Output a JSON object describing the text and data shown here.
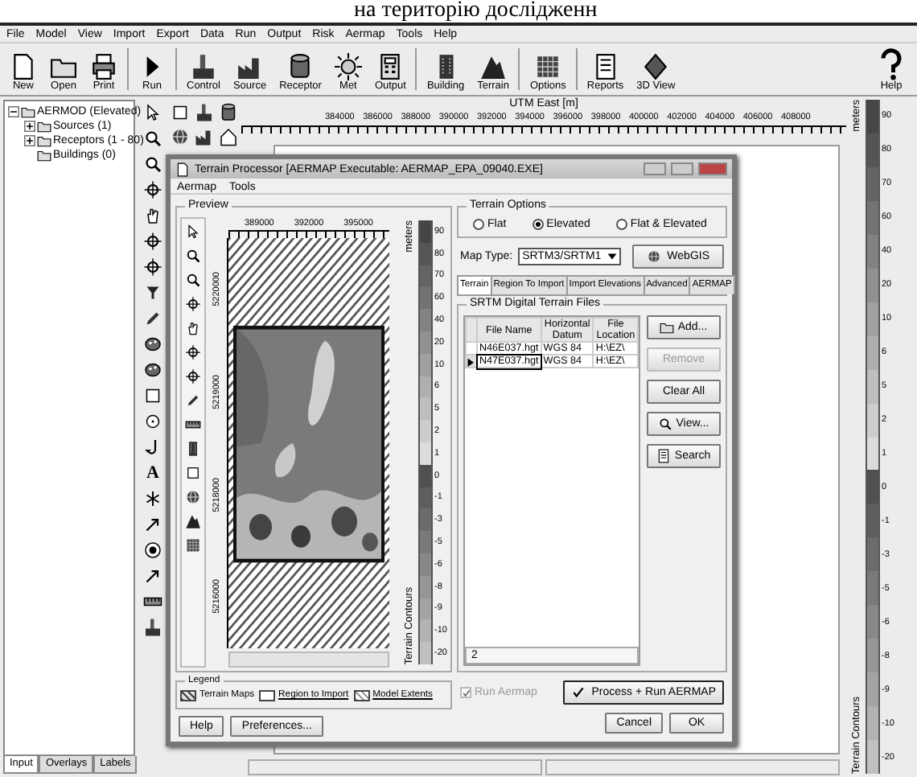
{
  "caption": "на територію дослідженн",
  "menu": [
    "File",
    "Model",
    "View",
    "Import",
    "Export",
    "Data",
    "Run",
    "Output",
    "Risk",
    "Aermap",
    "Tools",
    "Help"
  ],
  "toolbar": [
    [
      "New",
      "Open",
      "Print"
    ],
    [
      "Run"
    ],
    [
      "Control",
      "Source",
      "Receptor",
      "Met",
      "Output"
    ],
    [
      "Building",
      "Terrain"
    ],
    [
      "Options"
    ],
    [
      "Reports",
      "3D View"
    ]
  ],
  "help_button": "Help",
  "tree": {
    "label": "AERMOD (Elevated)",
    "expanded": true,
    "children": [
      {
        "label": "Sources (1)",
        "expanded": false
      },
      {
        "label": "Receptors (1 - 80)",
        "expanded": false
      },
      {
        "label": "Buildings (0)"
      }
    ]
  },
  "left_tabs": [
    {
      "label": "Input",
      "selected": true
    },
    {
      "label": "Overlays",
      "selected": false
    },
    {
      "label": "Labels",
      "selected": false
    }
  ],
  "tool_letter": "A",
  "map": {
    "axis_title": "UTM East [m]",
    "x_ticks": [
      "384000",
      "386000",
      "388000",
      "390000",
      "392000",
      "394000",
      "396000",
      "398000",
      "400000",
      "402000",
      "404000",
      "406000",
      "408000"
    ],
    "scale_unit": "meters",
    "scale_title": "Terrain Contours",
    "scale_labels": [
      "90",
      "80",
      "70",
      "60",
      "40",
      "20",
      "10",
      "6",
      "5",
      "2",
      "1",
      "0",
      "-1",
      "-3",
      "-5",
      "-6",
      "-8",
      "-9",
      "-10",
      "-20"
    ]
  },
  "dialog": {
    "title": "Terrain Processor [AERMAP Executable: AERMAP_EPA_09040.EXE]",
    "menu": [
      "Aermap",
      "Tools"
    ],
    "preview": {
      "title": "Preview",
      "x_ticks": [
        "389000",
        "392000",
        "395000"
      ],
      "y_ticks": [
        "5220000",
        "5219000",
        "5218000",
        "5216000"
      ],
      "scale_unit": "meters",
      "scale_title": "Terrain Contours",
      "scale_labels": [
        "90",
        "80",
        "70",
        "60",
        "40",
        "20",
        "10",
        "6",
        "5",
        "2",
        "1",
        "0",
        "-1",
        "-3",
        "-5",
        "-6",
        "-8",
        "-9",
        "-10",
        "-20"
      ]
    },
    "legend": {
      "title": "Legend",
      "items": [
        {
          "label": "Terrain Maps",
          "kind": "terrain"
        },
        {
          "label": "Region to Import",
          "kind": "region"
        },
        {
          "label": "Model Extents",
          "kind": "extents"
        }
      ]
    },
    "left_buttons": [
      "Help",
      "Preferences..."
    ],
    "terrain_options": {
      "title": "Terrain Options",
      "options": [
        {
          "label": "Flat",
          "selected": false
        },
        {
          "label": "Elevated",
          "selected": true
        },
        {
          "label": "Flat & Elevated",
          "selected": false
        }
      ]
    },
    "map_type": {
      "label": "Map Type:",
      "value": "SRTM3/SRTM1"
    },
    "webgis": "WebGIS",
    "tabs": [
      {
        "label": "Terrain",
        "selected": true
      },
      {
        "label": "Region To Import",
        "selected": false
      },
      {
        "label": "Import Elevations",
        "selected": false
      },
      {
        "label": "Advanced",
        "selected": false
      },
      {
        "label": "AERMAP",
        "selected": false
      }
    ],
    "files": {
      "title": "SRTM Digital Terrain Files",
      "columns": [
        "File Name",
        "Horizontal Datum",
        "File Location"
      ],
      "rows": [
        {
          "cells": [
            "N46E037.hgt",
            "WGS 84",
            "H:\\EZ\\"
          ],
          "selected": false
        },
        {
          "cells": [
            "N47E037.hgt",
            "WGS 84",
            "H:\\EZ\\"
          ],
          "selected": true
        }
      ],
      "count": "2"
    },
    "side_buttons": [
      {
        "label": "Add...",
        "disabled": false
      },
      {
        "label": "Remove",
        "disabled": true
      },
      {
        "label": "Clear All",
        "disabled": false
      },
      {
        "label": "View...",
        "disabled": false
      },
      {
        "label": "Search",
        "disabled": false
      }
    ],
    "run_aermap": {
      "label": "Run Aermap",
      "checked": true,
      "disabled": true
    },
    "process_button": "Process + Run AERMAP",
    "footer_buttons": [
      "Cancel",
      "OK"
    ]
  }
}
